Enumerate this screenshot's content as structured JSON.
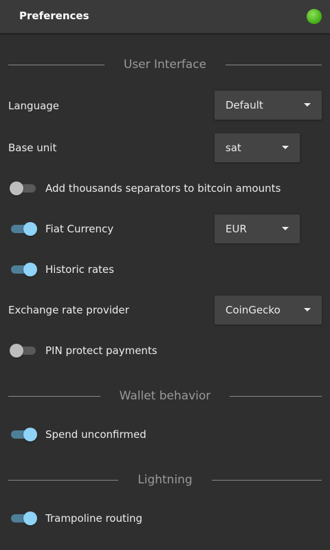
{
  "header": {
    "title": "Preferences",
    "status_color": "#4fb81f"
  },
  "sections": {
    "user_interface": "User Interface",
    "wallet_behavior": "Wallet behavior",
    "lightning": "Lightning"
  },
  "settings": {
    "language": {
      "label": "Language",
      "value": "Default"
    },
    "base_unit": {
      "label": "Base unit",
      "value": "sat"
    },
    "thousands_separators": {
      "label": "Add thousands separators to bitcoin amounts",
      "enabled": false
    },
    "fiat_currency": {
      "label": "Fiat Currency",
      "enabled": true,
      "value": "EUR"
    },
    "historic_rates": {
      "label": "Historic rates",
      "enabled": true
    },
    "exchange_rate_provider": {
      "label": "Exchange rate provider",
      "value": "CoinGecko"
    },
    "pin_protect": {
      "label": "PIN protect payments",
      "enabled": false
    },
    "spend_unconfirmed": {
      "label": "Spend unconfirmed",
      "enabled": true
    },
    "trampoline_routing": {
      "label": "Trampoline routing",
      "enabled": true
    }
  },
  "colors": {
    "toggle_on_knob": "#8fd3f7",
    "toggle_on_track": "#4e7f99",
    "toggle_off_knob": "#bdbdbd",
    "toggle_off_track": "#5a5a5a"
  }
}
